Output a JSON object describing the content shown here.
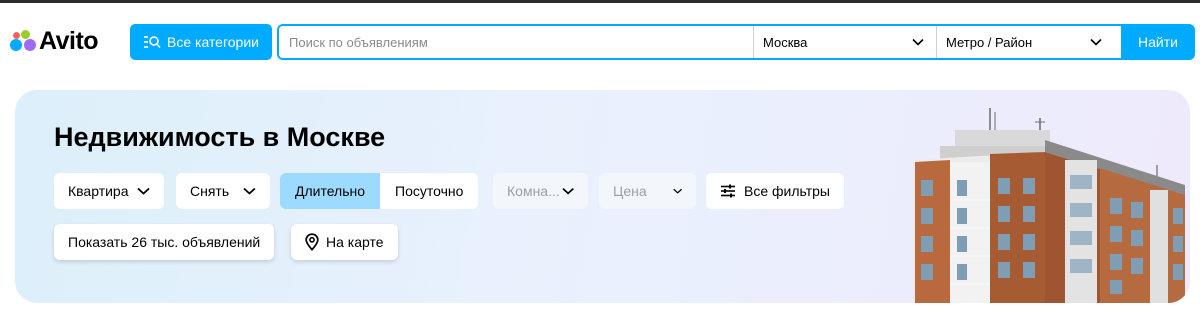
{
  "header": {
    "logo_text": "Avito",
    "logo_colors": [
      "#00aaff",
      "#97cf26",
      "#a169f7",
      "#ff6163"
    ],
    "categories_label": "Все категории",
    "search_placeholder": "Поиск по объявлениям",
    "city_value": "Москва",
    "metro_value": "Метро / Район",
    "find_label": "Найти",
    "accent_color": "#00aaff"
  },
  "hero": {
    "title": "Недвижимость в Москве",
    "filters": {
      "property_type": "Квартира",
      "deal_type": "Снять",
      "term_options": [
        "Длительно",
        "Посуточно"
      ],
      "term_selected": "Длительно",
      "rooms_placeholder": "Комна...",
      "price_placeholder": "Цена",
      "all_filters_label": "Все фильтры"
    },
    "show_results_label": "Показать 26 тыс. объявлений",
    "map_label": "На карте"
  },
  "icons": {
    "categories": "search-list-icon",
    "chevron": "chevron-down-icon",
    "filters": "sliders-icon",
    "map": "map-pin-icon"
  }
}
